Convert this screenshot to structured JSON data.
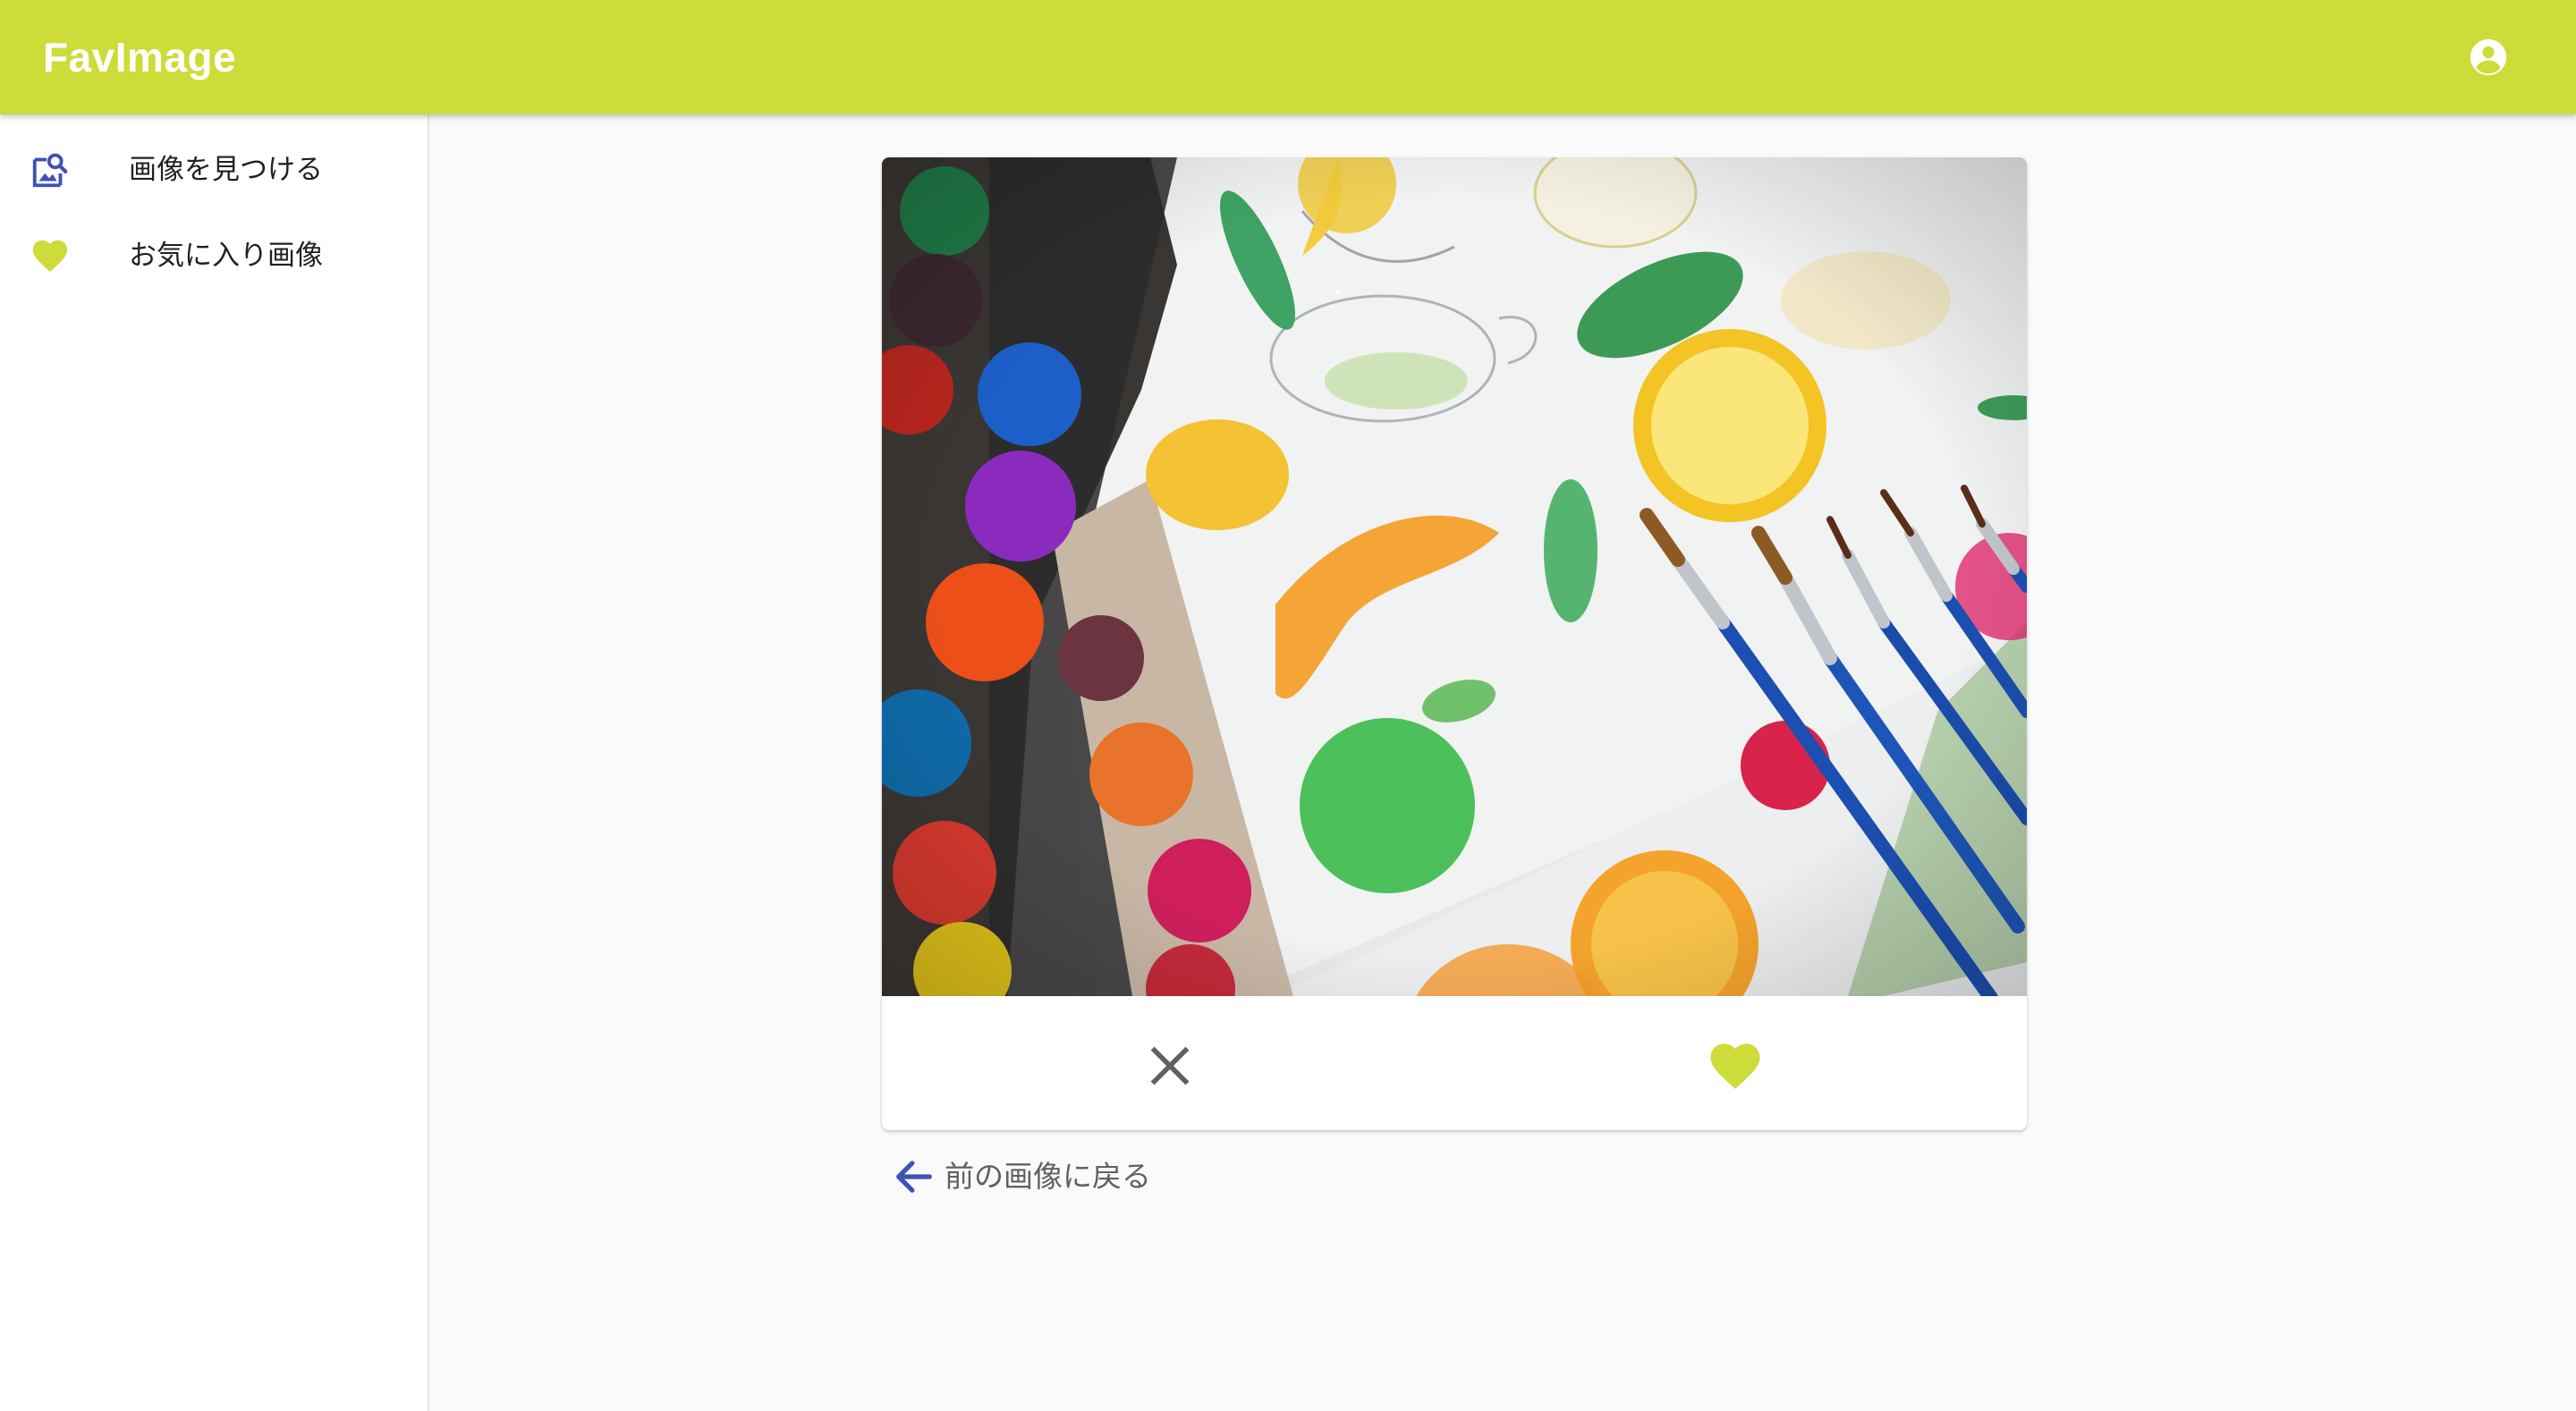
{
  "app": {
    "title": "FavImage"
  },
  "header": {
    "account_icon": "account-circle-icon"
  },
  "sidebar": {
    "items": [
      {
        "label": "画像を見つける",
        "icon": "image-search-icon",
        "icon_color": "#3f51b5"
      },
      {
        "label": "お気に入り画像",
        "icon": "heart-icon",
        "icon_color": "#cddc39"
      }
    ]
  },
  "card": {
    "image_icon": "watercolor-paints-photo",
    "actions": [
      {
        "icon": "close-icon",
        "color": "#616161"
      },
      {
        "icon": "heart-icon",
        "color": "#cddc39"
      }
    ]
  },
  "back_link": {
    "label": "前の画像に戻る",
    "icon": "arrow-left-icon",
    "icon_color": "#3f51b5"
  },
  "colors": {
    "primary": "#cddc39",
    "accent": "#3f51b5",
    "background": "#fafafa"
  }
}
